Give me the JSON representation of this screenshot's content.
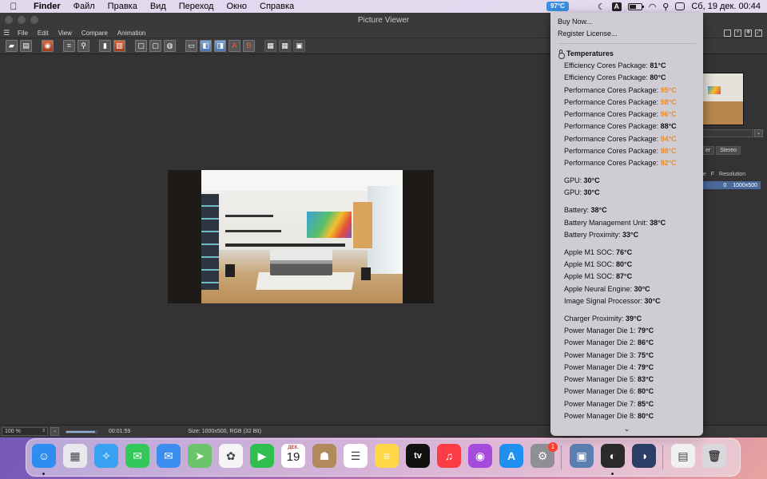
{
  "menubar": {
    "app_name": "Finder",
    "items": [
      "Файл",
      "Правка",
      "Вид",
      "Переход",
      "Окно",
      "Справка"
    ],
    "temp_badge": "97°C",
    "kbd_layout": "A",
    "datetime": "Сб, 19 дек.  00:44"
  },
  "window": {
    "title": "Picture Viewer",
    "menu": [
      "File",
      "Edit",
      "View",
      "Compare",
      "Animation"
    ]
  },
  "right_panel": {
    "tabs": [
      "er",
      "Stereo"
    ],
    "columns": [
      "me",
      "F",
      "Resolution"
    ],
    "row": {
      "f": "0",
      "resolution": "1000x500"
    }
  },
  "statusbar": {
    "zoom": "100 %",
    "progress": 0.95,
    "time": "00:01:59",
    "size_info": "Size: 1000x500, RGB (32 Bit)"
  },
  "dropdown": {
    "links": [
      "Buy Now...",
      "Register License..."
    ],
    "section_title": "Temperatures",
    "groups": [
      [
        {
          "label": "Efficiency Cores Package:",
          "value": "81°C",
          "hot": false
        },
        {
          "label": "Efficiency Cores Package:",
          "value": "80°C",
          "hot": false
        },
        {
          "label": "Performance Cores Package:",
          "value": "95°C",
          "hot": true
        },
        {
          "label": "Performance Cores Package:",
          "value": "98°C",
          "hot": true
        },
        {
          "label": "Performance Cores Package:",
          "value": "96°C",
          "hot": true
        },
        {
          "label": "Performance Cores Package:",
          "value": "88°C",
          "hot": false
        },
        {
          "label": "Performance Cores Package:",
          "value": "94°C",
          "hot": true
        },
        {
          "label": "Performance Cores Package:",
          "value": "98°C",
          "hot": true
        },
        {
          "label": "Performance Cores Package:",
          "value": "92°C",
          "hot": true
        }
      ],
      [
        {
          "label": "GPU:",
          "value": "30°C",
          "hot": false
        },
        {
          "label": "GPU:",
          "value": "30°C",
          "hot": false
        }
      ],
      [
        {
          "label": "Battery:",
          "value": "38°C",
          "hot": false
        },
        {
          "label": "Battery Management Unit:",
          "value": "38°C",
          "hot": false
        },
        {
          "label": "Battery Proximity:",
          "value": "33°C",
          "hot": false
        }
      ],
      [
        {
          "label": "Apple M1 SOC:",
          "value": "76°C",
          "hot": false
        },
        {
          "label": "Apple M1 SOC:",
          "value": "80°C",
          "hot": false
        },
        {
          "label": "Apple M1 SOC:",
          "value": "87°C",
          "hot": false
        },
        {
          "label": "Apple Neural Engine:",
          "value": "30°C",
          "hot": false
        },
        {
          "label": "Image Signal Processor:",
          "value": "30°C",
          "hot": false
        }
      ],
      [
        {
          "label": "Charger Proximity:",
          "value": "39°C",
          "hot": false
        },
        {
          "label": "Power Manager Die 1:",
          "value": "79°C",
          "hot": false
        },
        {
          "label": "Power Manager Die 2:",
          "value": "86°C",
          "hot": false
        },
        {
          "label": "Power Manager Die 3:",
          "value": "75°C",
          "hot": false
        },
        {
          "label": "Power Manager Die 4:",
          "value": "79°C",
          "hot": false
        },
        {
          "label": "Power Manager Die 5:",
          "value": "83°C",
          "hot": false
        },
        {
          "label": "Power Manager Die 6:",
          "value": "80°C",
          "hot": false
        },
        {
          "label": "Power Manager Die 7:",
          "value": "85°C",
          "hot": false
        },
        {
          "label": "Power Manager Die 8:",
          "value": "80°C",
          "hot": false
        }
      ]
    ],
    "more": "⌄"
  },
  "dock": {
    "calendar_month": "ДЕК.",
    "calendar_day": "19",
    "appstore_badge": "1",
    "tv_label": "tv",
    "apps": [
      {
        "name": "finder",
        "color": "#2f8cf0",
        "glyph": "☺"
      },
      {
        "name": "launchpad",
        "color": "#e8e8ec",
        "glyph": "▦"
      },
      {
        "name": "safari",
        "color": "#3aa0f0",
        "glyph": "✧"
      },
      {
        "name": "messages",
        "color": "#34c759",
        "glyph": "✉"
      },
      {
        "name": "mail",
        "color": "#3b8ef0",
        "glyph": "✉"
      },
      {
        "name": "maps",
        "color": "#6cc46a",
        "glyph": "➤"
      },
      {
        "name": "photos",
        "color": "#f5f5f5",
        "glyph": "✿"
      },
      {
        "name": "facetime",
        "color": "#2fbf4f",
        "glyph": "▶"
      },
      {
        "name": "calendar",
        "color": "#ffffff",
        "glyph": ""
      },
      {
        "name": "contacts",
        "color": "#b08a5a",
        "glyph": "☗"
      },
      {
        "name": "reminders",
        "color": "#ffffff",
        "glyph": "☰"
      },
      {
        "name": "notes",
        "color": "#ffd84a",
        "glyph": "≡"
      },
      {
        "name": "apple-tv",
        "color": "#111111",
        "glyph": ""
      },
      {
        "name": "music",
        "color": "#fc3c44",
        "glyph": "♫"
      },
      {
        "name": "podcasts",
        "color": "#a54bdb",
        "glyph": "◉"
      },
      {
        "name": "app-store",
        "color": "#1f8ff0",
        "glyph": "A"
      },
      {
        "name": "system-preferences",
        "color": "#8e8e93",
        "glyph": "⚙"
      },
      {
        "name": "preview",
        "color": "#5a7fb0",
        "glyph": "▣"
      },
      {
        "name": "cinema-4d",
        "color": "#2a2a2a",
        "glyph": "◐"
      },
      {
        "name": "cinema-4d-lite",
        "color": "#2b3f66",
        "glyph": "◑"
      },
      {
        "name": "document",
        "color": "#f0f0f0",
        "glyph": "▤"
      },
      {
        "name": "trash",
        "color": "#d8d8dc",
        "glyph": "🗑"
      }
    ]
  }
}
